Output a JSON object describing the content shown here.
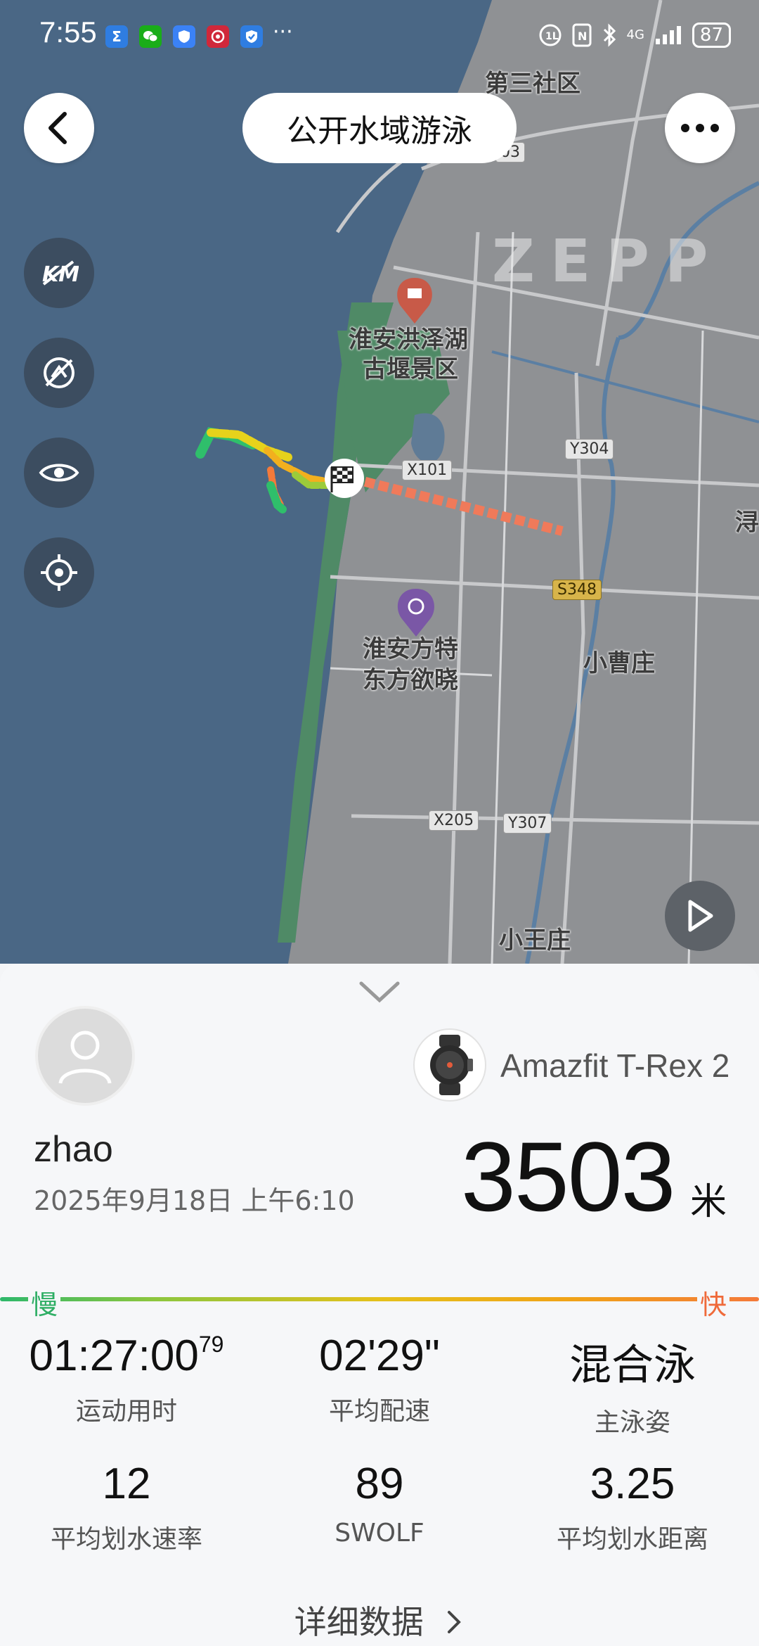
{
  "status_bar": {
    "time": "7:55",
    "dots": "···",
    "battery": "87",
    "network": "4G"
  },
  "header": {
    "title": "公开水域游泳"
  },
  "map": {
    "watermark": "ZEPP",
    "labels": {
      "district_3": "第三社区",
      "scenic_1": "淮安洪泽湖",
      "scenic_2": "古堰景区",
      "poi_1": "淮安方特",
      "poi_2": "东方欲晓",
      "village_cao": "小曹庄",
      "village_wang": "小王庄",
      "edge_char": "浔"
    },
    "roads": {
      "x101": "X101",
      "y304": "Y304",
      "s348": "S348",
      "x205": "X205",
      "y307": "Y307",
      "top_partial": "03"
    }
  },
  "summary": {
    "device_name": "Amazfit T-Rex 2",
    "user_name": "zhao",
    "datetime": "2025年9月18日 上午6:10",
    "distance": "3503",
    "distance_unit": "米",
    "pace_slow": "慢",
    "pace_fast": "快"
  },
  "stats": [
    {
      "value": "01:27:00",
      "sup": "79",
      "label": "运动用时"
    },
    {
      "value": "02'29\"",
      "label": "平均配速"
    },
    {
      "value": "混合泳",
      "label": "主泳姿"
    },
    {
      "value": "12",
      "label": "平均划水速率"
    },
    {
      "value": "89",
      "label": "SWOLF"
    },
    {
      "value": "3.25",
      "label": "平均划水距离"
    }
  ],
  "details_link": "详细数据"
}
